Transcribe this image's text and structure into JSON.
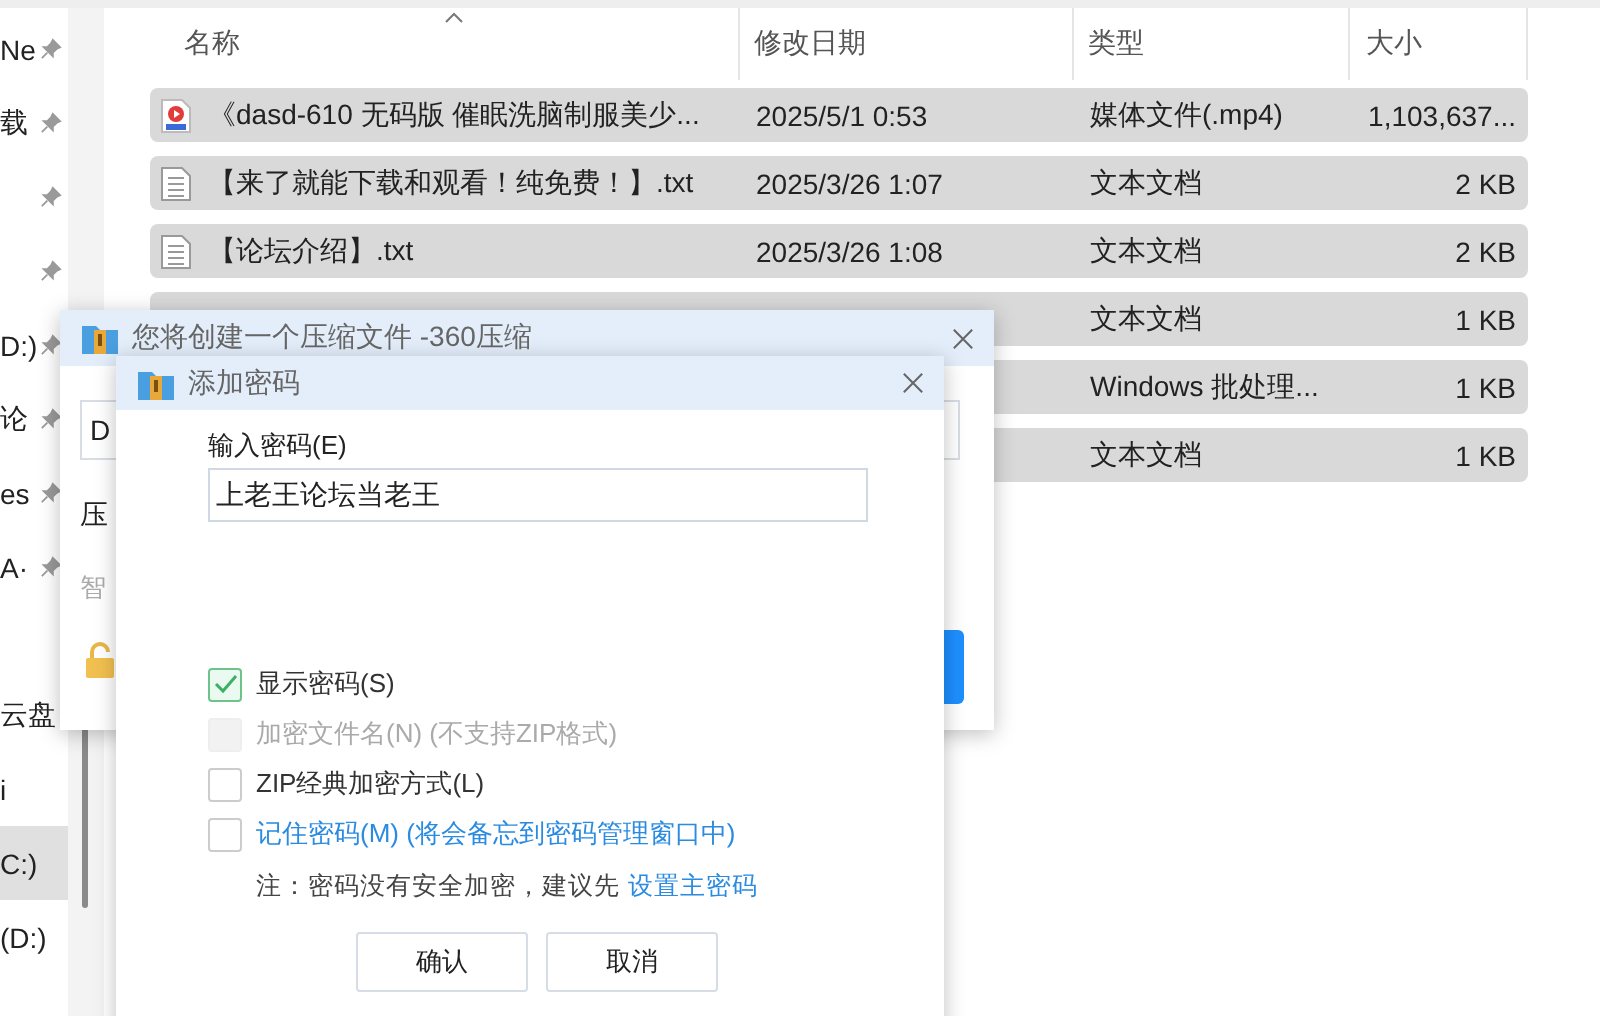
{
  "sidebar": {
    "items": [
      {
        "label": "Ne",
        "pinned": true,
        "selected": false
      },
      {
        "label": "载",
        "pinned": true,
        "selected": false
      },
      {
        "pinned": true,
        "selected": false
      },
      {
        "pinned": true,
        "selected": false
      },
      {
        "label": "D:)",
        "pinned": true,
        "selected": false
      },
      {
        "label": "论",
        "pinned": true,
        "selected": false
      },
      {
        "label": "es",
        "pinned": true,
        "selected": false
      },
      {
        "label": "A·",
        "pinned": true,
        "selected": false
      }
    ],
    "drives": [
      {
        "label": "云盘",
        "selected": false
      },
      {
        "label": "i",
        "selected": false
      },
      {
        "label": "C:)",
        "selected": true
      },
      {
        "label": "(D:)",
        "selected": false
      }
    ]
  },
  "file_list": {
    "columns": [
      "名称",
      "修改日期",
      "类型",
      "大小"
    ],
    "rows": [
      {
        "kind": "video",
        "name": "《dasd-610 无码版 催眠洗脑制服美少...",
        "modified": "2025/5/1 0:53",
        "type": "媒体文件(.mp4)",
        "size": "1,103,637...",
        "selected": true
      },
      {
        "kind": "text",
        "name": "【来了就能下载和观看！纯免费！】.txt",
        "modified": "2025/3/26 1:07",
        "type": "文本文档",
        "size": "2 KB",
        "selected": true
      },
      {
        "kind": "text",
        "name": "【论坛介绍】.txt",
        "modified": "2025/3/26 1:08",
        "type": "文本文档",
        "size": "2 KB",
        "selected": true
      },
      {
        "type": "文本文档",
        "size": "1 KB",
        "selected": true
      },
      {
        "type": "Windows 批处理...",
        "size": "1 KB",
        "selected": true
      },
      {
        "type": "文本文档",
        "size": "1 KB",
        "selected": true
      }
    ]
  },
  "compress_dialog": {
    "title": "您将创建一个压缩文件 -360压缩",
    "path_value": "D",
    "label": "压",
    "hint": "智"
  },
  "password_dialog": {
    "title": "添加密码",
    "password_label": "输入密码(E)",
    "password_value": "上老王论坛当老王",
    "options": [
      {
        "kind": "plain",
        "label": "显示密码(S)",
        "checked": true,
        "disabled": false
      },
      {
        "kind": "plain",
        "label": "加密文件名(N) (不支持ZIP格式)",
        "checked": false,
        "disabled": true
      },
      {
        "kind": "plain",
        "label": "ZIP经典加密方式(L)",
        "checked": false,
        "disabled": false
      },
      {
        "kind": "link",
        "label": "记住密码(M) (将会备忘到密码管理窗口中)",
        "checked": false,
        "disabled": false
      }
    ],
    "note": "注：密码没有安全加密，建议先",
    "note_link": "设置主密码",
    "buttons": [
      "确认",
      "取消"
    ]
  }
}
